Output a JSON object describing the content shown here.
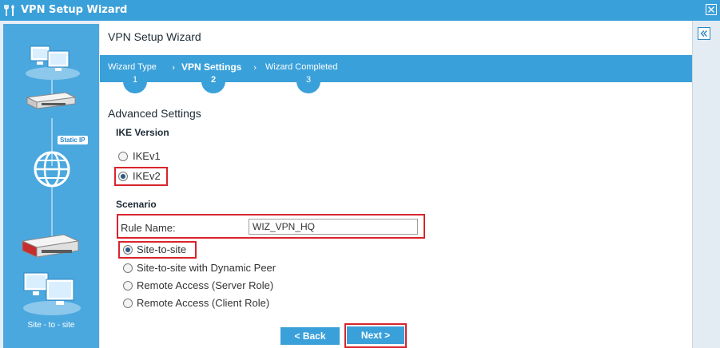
{
  "window": {
    "title": "VPN Setup Wizard"
  },
  "page": {
    "title": "VPN Setup Wizard"
  },
  "steps": [
    {
      "label": "Wizard Type",
      "number": "1"
    },
    {
      "label": "VPN Settings",
      "number": "2"
    },
    {
      "label": "Wizard Completed",
      "number": "3"
    }
  ],
  "advanced": {
    "heading": "Advanced Settings",
    "ike_heading": "IKE Version",
    "ike_options": [
      {
        "label": "IKEv1",
        "checked": false
      },
      {
        "label": "IKEv2",
        "checked": true
      }
    ],
    "scenario_heading": "Scenario",
    "rule_name_label": "Rule Name:",
    "rule_name_value": "WIZ_VPN_HQ",
    "scenarios": [
      {
        "label": "Site-to-site",
        "checked": true
      },
      {
        "label": "Site-to-site with Dynamic Peer",
        "checked": false
      },
      {
        "label": "Remote Access (Server Role)",
        "checked": false
      },
      {
        "label": "Remote Access (Client Role)",
        "checked": false
      }
    ]
  },
  "buttons": {
    "back": "< Back",
    "next": "Next >"
  },
  "sidebar": {
    "static_ip_tag": "Static IP",
    "caption": "Site - to - site"
  },
  "colors": {
    "accent": "#3aa0d9",
    "highlight": "#d8242c",
    "sidebar": "#4ba8de"
  }
}
